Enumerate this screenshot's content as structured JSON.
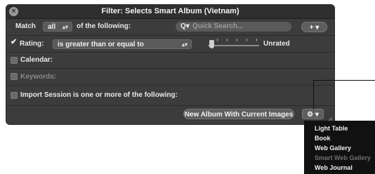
{
  "window": {
    "title": "Filter: Selects Smart Album (Vietnam)"
  },
  "match_row": {
    "prefix": "Match",
    "select_value": "all",
    "suffix": "of the following:",
    "search_placeholder": "Quick Search...",
    "add_button": "+ ▾"
  },
  "rating_row": {
    "label": "Rating:",
    "checked": true,
    "operator": "is greater than or equal to",
    "value_label": "Unrated"
  },
  "calendar_row": {
    "label": "Calendar:"
  },
  "keywords_row": {
    "label": "Keywords:"
  },
  "import_row": {
    "label": "Import Session is one or more of the following:"
  },
  "footer": {
    "new_album_button": "New Album With Current Images",
    "action_button": "⚙ ▾"
  },
  "action_menu": {
    "items": [
      {
        "label": "Light Table",
        "enabled": true
      },
      {
        "label": "Book",
        "enabled": true
      },
      {
        "label": "Web Gallery",
        "enabled": true
      },
      {
        "label": "Smart Web Gallery",
        "enabled": false
      },
      {
        "label": "Web Journal",
        "enabled": true
      }
    ]
  }
}
